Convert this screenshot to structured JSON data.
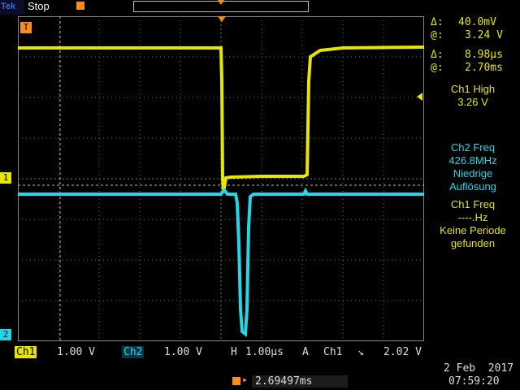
{
  "header": {
    "brand": "Tek",
    "run_state": "Stop"
  },
  "plot": {
    "ch1_marker": "1",
    "ch2_marker": "2",
    "trigger_marker": "T"
  },
  "cursor": {
    "delta_v_label": "Δ:",
    "delta_v": "40.0mV",
    "at_v_label": "@:",
    "at_v": "3.24 V",
    "delta_t_label": "Δ:",
    "delta_t": "8.98µs",
    "at_t_label": "@:",
    "at_t": "2.70ms"
  },
  "measurements": {
    "ch1_high_title": "Ch1 High",
    "ch1_high_value": "3.26 V",
    "ch2_freq_title": "Ch2 Freq",
    "ch2_freq_value": "426.8MHz",
    "ch2_freq_note1": "Niedrige",
    "ch2_freq_note2": "Auflösung",
    "ch1_freq_title": "Ch1 Freq",
    "ch1_freq_value": "----.Hz",
    "ch1_freq_note1": "Keine Periode",
    "ch1_freq_note2": "gefunden"
  },
  "status_bar": {
    "ch1_label": "Ch1",
    "ch1_scale": "1.00 V",
    "ch2_label": "Ch2",
    "ch2_scale": "1.00 V",
    "h_label": "H",
    "h_scale": "1.00µs",
    "acq_mode": "A",
    "trig_source": "Ch1",
    "trig_slope": "↘",
    "trig_level": "2.02 V",
    "trig_position": "2.69497ms",
    "date": "2 Feb  2017",
    "time": "07:59:20"
  },
  "colors": {
    "ch1": "#e6e600",
    "ch2": "#22d8e8",
    "trigger": "#ff8c1a"
  }
}
